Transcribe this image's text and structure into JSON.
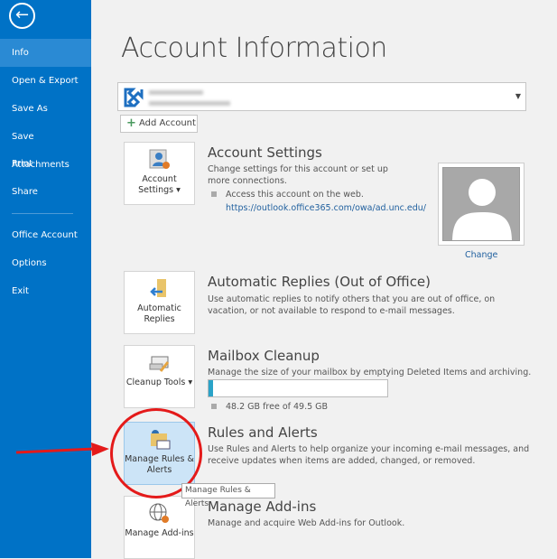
{
  "sidebar": {
    "items": [
      {
        "label": "Info",
        "selected": true
      },
      {
        "label": "Open & Export"
      },
      {
        "label": "Save As"
      },
      {
        "label": "Save Attachments"
      },
      {
        "label": "Print"
      },
      {
        "label": "Share"
      },
      {
        "label": "Office Account"
      },
      {
        "label": "Options"
      },
      {
        "label": "Exit"
      }
    ]
  },
  "page_title": "Account Information",
  "add_account": "Add Account",
  "sections": {
    "account_settings": {
      "tile": "Account Settings",
      "heading": "Account Settings",
      "desc": "Change settings for this account or set up more connections.",
      "bullet": "Access this account on the web.",
      "link": "https://outlook.office365.com/owa/ad.unc.edu/"
    },
    "photo_change": "Change",
    "auto_replies": {
      "tile": "Automatic Replies",
      "heading": "Automatic Replies (Out of Office)",
      "desc": "Use automatic replies to notify others that you are out of office, on vacation, or not available to respond to e-mail messages."
    },
    "cleanup": {
      "tile": "Cleanup Tools",
      "heading": "Mailbox Cleanup",
      "desc": "Manage the size of your mailbox by emptying Deleted Items and archiving.",
      "usage": "48.2 GB free of 49.5 GB",
      "used_fraction": 0.026
    },
    "rules": {
      "tile": "Manage Rules & Alerts",
      "heading": "Rules and Alerts",
      "desc": "Use Rules and Alerts to help organize your incoming e-mail messages, and receive updates when items are added, changed, or removed.",
      "tooltip": "Manage Rules & Alerts"
    },
    "addins": {
      "tile": "Manage Add-ins",
      "heading": "Manage Add-ins",
      "desc": "Manage and acquire Web Add-ins for Outlook."
    }
  },
  "colors": {
    "sidebar": "#0072c6",
    "annotation": "#e41a1a"
  }
}
